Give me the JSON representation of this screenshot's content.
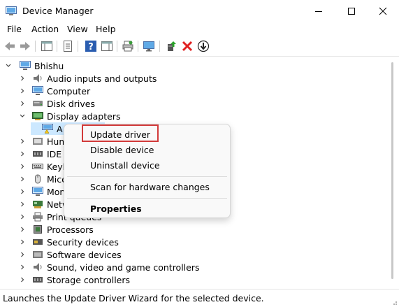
{
  "window": {
    "title": "Device Manager"
  },
  "menu": [
    "File",
    "Action",
    "View",
    "Help"
  ],
  "tree": {
    "root": "Bhishu",
    "items": [
      "Audio inputs and outputs",
      "Computer",
      "Disk drives",
      "Display adapters",
      "A",
      "Hum",
      "IDE A",
      "Keyb",
      "Mice",
      "Mon",
      "Netw",
      "Print queues",
      "Processors",
      "Security devices",
      "Software devices",
      "Sound, video and game controllers",
      "Storage controllers"
    ]
  },
  "context_menu": {
    "update_driver": "Update driver",
    "disable_device": "Disable device",
    "uninstall_device": "Uninstall device",
    "scan_hardware": "Scan for hardware changes",
    "properties": "Properties"
  },
  "status": "Launches the Update Driver Wizard for the selected device.",
  "colors": {
    "highlight_border": "#d23a3a",
    "delete_red": "#e02020",
    "help_blue": "#2a5db0"
  }
}
